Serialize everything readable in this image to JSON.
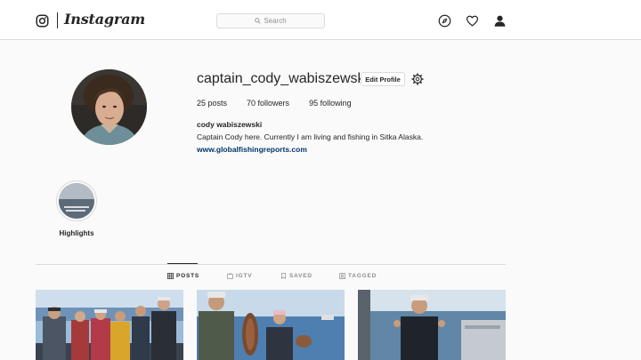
{
  "header": {
    "wordmark": "Instagram",
    "search_placeholder": "Search"
  },
  "icons": {
    "logo": "instagram-glyph-icon",
    "search": "search-icon",
    "explore": "compass-icon",
    "activity": "heart-icon",
    "profile": "person-icon",
    "settings": "gear-icon",
    "tab_posts": "grid-icon",
    "tab_igtv": "tv-icon",
    "tab_saved": "bookmark-icon",
    "tab_tagged": "tag-icon"
  },
  "profile": {
    "username": "captain_cody_wabiszewski",
    "edit_button": "Edit Profile",
    "stats": {
      "posts": "25 posts",
      "followers": "70 followers",
      "following": "95 following"
    },
    "full_name": "cody wabiszewski",
    "bio": "Captain Cody here. Currently I am living and fishing in Sitka Alaska.",
    "website": "www.globalfishingreports.com"
  },
  "highlights": [
    {
      "label": "Highlights"
    }
  ],
  "tabs": [
    {
      "label": "POSTS",
      "active": true
    },
    {
      "label": "IGTV",
      "active": false
    },
    {
      "label": "SAVED",
      "active": false
    },
    {
      "label": "TAGGED",
      "active": false
    }
  ],
  "colors": {
    "background": "#fafafa",
    "border": "#dbdbdb",
    "text": "#262626",
    "muted": "#8e8e8e",
    "link": "#00376b"
  }
}
